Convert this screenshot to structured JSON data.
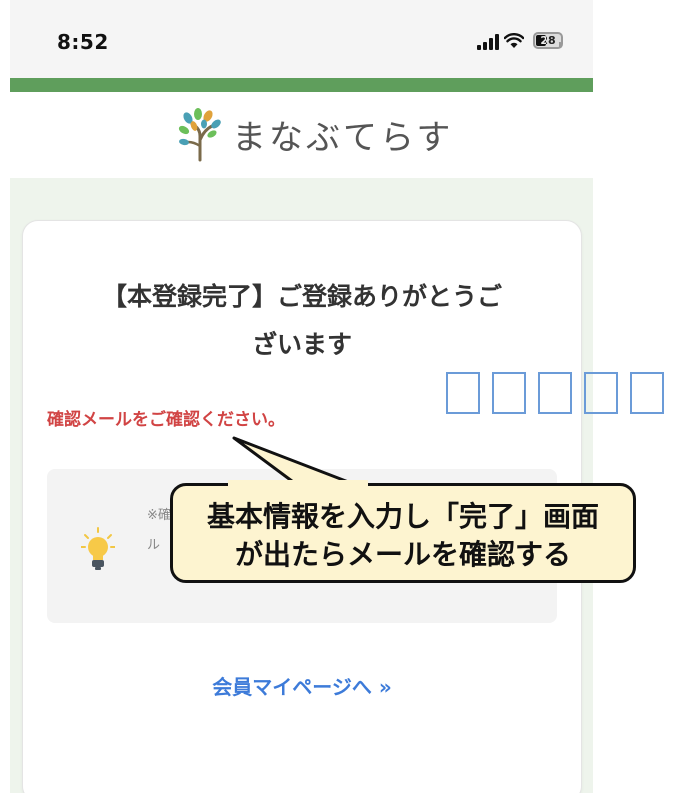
{
  "status_bar": {
    "time": "8:52",
    "battery": "28"
  },
  "header": {
    "logo_text": "まなぶてらす"
  },
  "card": {
    "title_line1": "【本登録完了】ご登録ありがとうご",
    "title_line2": "ざいます",
    "alert": "確認メールをご確認ください。",
    "info_text_line1": "※確",
    "info_text_line2": "ル",
    "mypage_link": "会員マイページへ »"
  },
  "callout": {
    "line1": "基本情報を入力し「完了」画面",
    "line2": "が出たらメールを確認する"
  },
  "colors": {
    "accent_green": "#5f9e5c",
    "alert_red": "#d14444",
    "link_blue": "#3d7bd9",
    "callout_bg": "#fdf4d0"
  },
  "icons": [
    "tree-logo-icon",
    "lightbulb-icon",
    "signal-icon",
    "wifi-icon",
    "battery-icon"
  ]
}
